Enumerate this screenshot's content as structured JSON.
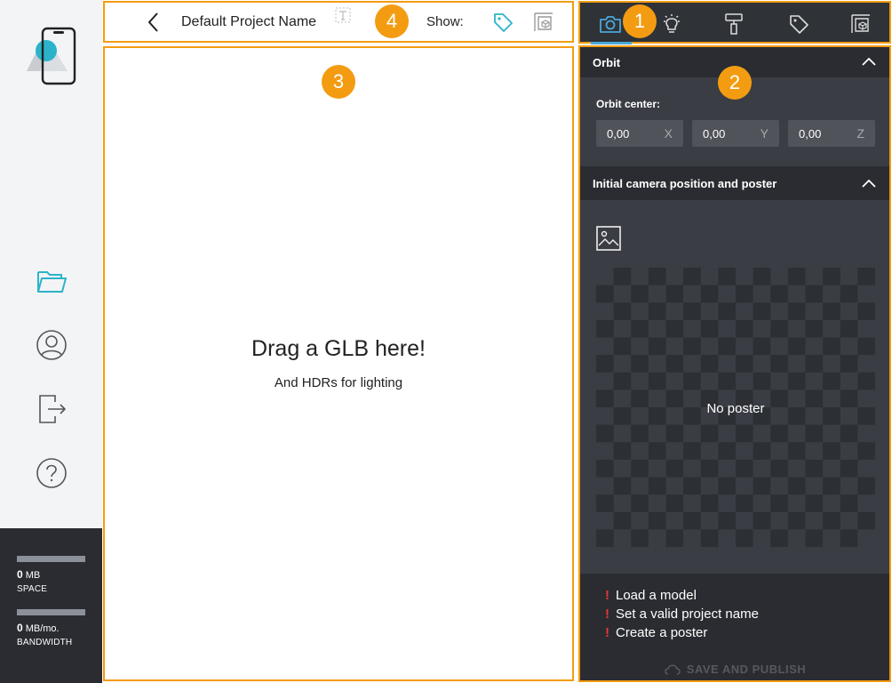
{
  "header": {
    "project_name": "Default Project Name",
    "show_label": "Show:"
  },
  "viewer": {
    "drop_title": "Drag a GLB here!",
    "drop_subtitle": "And HDRs for lighting"
  },
  "usage": {
    "space_value": "0",
    "space_unit": "MB",
    "space_label": "SPACE",
    "bandwidth_value": "0",
    "bandwidth_unit": "MB/mo.",
    "bandwidth_label": "BANDWIDTH"
  },
  "badges": [
    "1",
    "2",
    "3",
    "4"
  ],
  "panel": {
    "orbit": {
      "title": "Orbit",
      "center_label": "Orbit center:",
      "coords": [
        {
          "value": "0,00",
          "axis": "X"
        },
        {
          "value": "0,00",
          "axis": "Y"
        },
        {
          "value": "0,00",
          "axis": "Z"
        }
      ]
    },
    "camera": {
      "title": "Initial camera position and poster",
      "no_poster": "No poster"
    },
    "warnings": [
      "Load a model",
      "Set a valid project name",
      "Create a poster"
    ],
    "save_label": "SAVE AND PUBLISH"
  },
  "tabs": [
    "camera-icon",
    "lightbulb-icon",
    "paint-roller-icon",
    "tag-icon",
    "dimensions-icon"
  ],
  "colors": {
    "accent": "#f39c12",
    "active_tab": "#4aa8d8",
    "nav_active": "#2bb3c9",
    "panel_bg": "#3a3d43",
    "panel_dark": "#2a2c31",
    "warning": "#e53935"
  }
}
